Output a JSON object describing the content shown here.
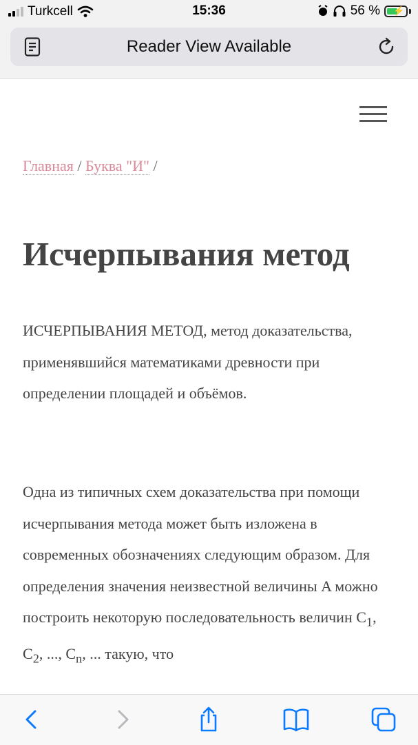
{
  "status_bar": {
    "carrier": "Turkcell",
    "time": "15:36",
    "battery_percent": "56 %",
    "signal_bars": 4,
    "signal_bars_active": 2,
    "battery_level": 0.56,
    "battery_color": "#34c759",
    "icons": [
      "cellular-signal-icon",
      "wifi-icon",
      "alarm-icon",
      "headphones-icon",
      "battery-charging-icon"
    ]
  },
  "url_bar": {
    "text": "Reader View Available",
    "left_icon": "reader-icon",
    "right_icon": "reload-icon"
  },
  "page": {
    "menu_icon": "hamburger-menu-icon",
    "breadcrumb": {
      "home": "Главная",
      "sep1": " / ",
      "letter": "Буква \"И\"",
      "sep2": " /"
    },
    "title": "Исчерпывания метод",
    "paragraph1": "ИСЧЕРПЫВАНИЯ МЕТОД, метод доказательства, применявшийся математиками древности при определении площадей и объёмов.",
    "paragraph2": {
      "text": "Одна из типичных схем доказательства при помощи исчерпывания метода может быть изложена в современных обозначениях следующим образом. Для определения значения неизвестной величины A можно построить некоторую последовательность величин ",
      "c1": "C",
      "c1_sub": "1",
      "comma1": ", ",
      "c2": "C",
      "c2_sub": "2",
      "mid": ", ..., ",
      "cn": "C",
      "cn_sub": "n",
      "tail": ", ... такую, что"
    },
    "link_color": "#d98a9a",
    "text_color": "#444444"
  },
  "toolbar": {
    "back": "chevron-left-icon",
    "forward": "chevron-right-icon",
    "share": "share-icon",
    "bookmarks": "book-icon",
    "tabs": "tabs-icon",
    "accent": "#0a7aff"
  }
}
